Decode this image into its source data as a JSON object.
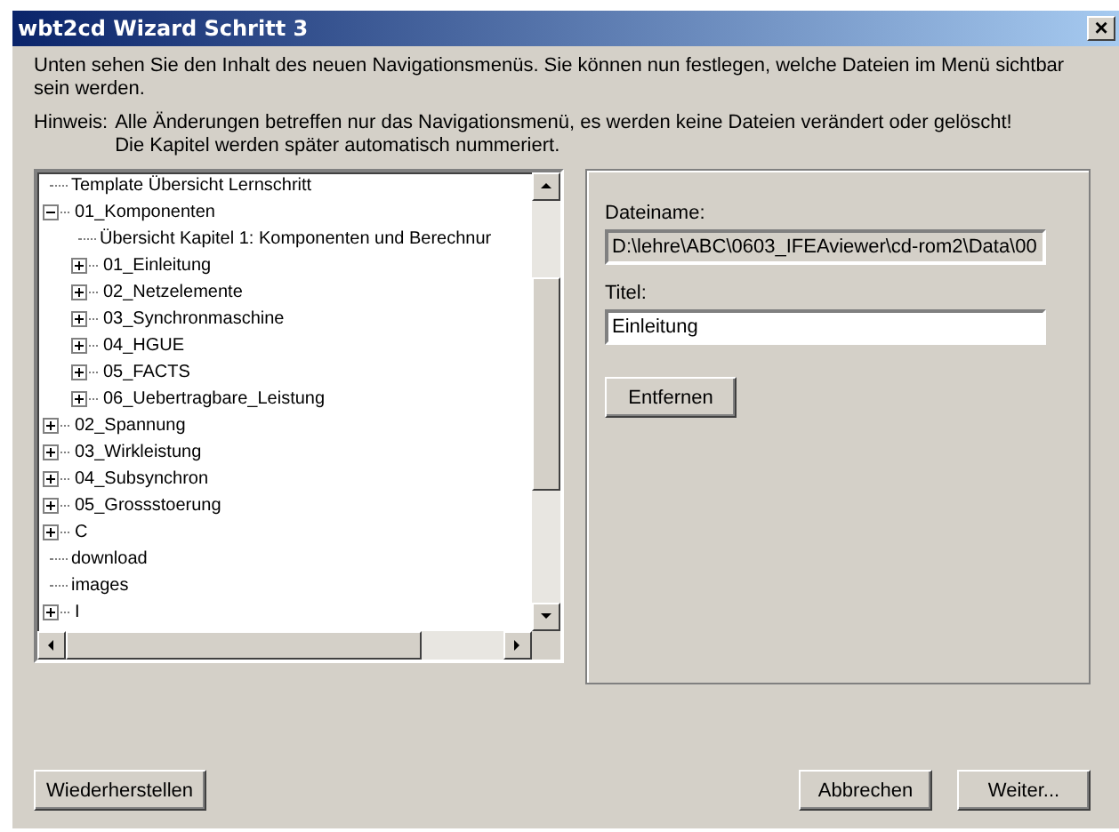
{
  "window": {
    "title": "wbt2cd Wizard Schritt 3",
    "close": "×"
  },
  "intro": "Unten sehen Sie den Inhalt des neuen Navigationsmenüs. Sie können nun festlegen, welche Dateien im Menü sichtbar sein werden.",
  "hint": {
    "label": "Hinweis:",
    "lines": [
      "Alle Änderungen betreffen nur das Navigationsmenü, es werden keine Dateien verändert oder gelöscht!",
      "Die Kapitel werden später automatisch nummeriert."
    ]
  },
  "tree": [
    {
      "label": "Template Übersicht Lernschritt"
    },
    {
      "label": "01_Komponenten",
      "expanded": true,
      "children": [
        {
          "label": "Übersicht Kapitel 1: Komponenten und Berechnur"
        },
        {
          "label": "01_Einleitung",
          "expanded": false
        },
        {
          "label": "02_Netzelemente",
          "expanded": false
        },
        {
          "label": "03_Synchronmaschine",
          "expanded": false
        },
        {
          "label": "04_HGUE",
          "expanded": false
        },
        {
          "label": "05_FACTS",
          "expanded": false
        },
        {
          "label": "06_Uebertragbare_Leistung",
          "expanded": false
        }
      ]
    },
    {
      "label": "02_Spannung",
      "expanded": false
    },
    {
      "label": "03_Wirkleistung",
      "expanded": false
    },
    {
      "label": "04_Subsynchron",
      "expanded": false
    },
    {
      "label": "05_Grossstoerung",
      "expanded": false
    },
    {
      "label": "C",
      "expanded": false
    },
    {
      "label": "download"
    },
    {
      "label": "images"
    },
    {
      "label": "I",
      "expanded": false
    }
  ],
  "details": {
    "filename_label": "Dateiname:",
    "filename": "D:\\lehre\\ABC\\0603_IFEAviewer\\cd-rom2\\Data\\00",
    "title_label": "Titel:",
    "title": "Einleitung",
    "remove_button": "Entfernen"
  },
  "buttons": {
    "restore": "Wiederherstellen",
    "cancel": "Abbrechen",
    "next": "Weiter..."
  }
}
